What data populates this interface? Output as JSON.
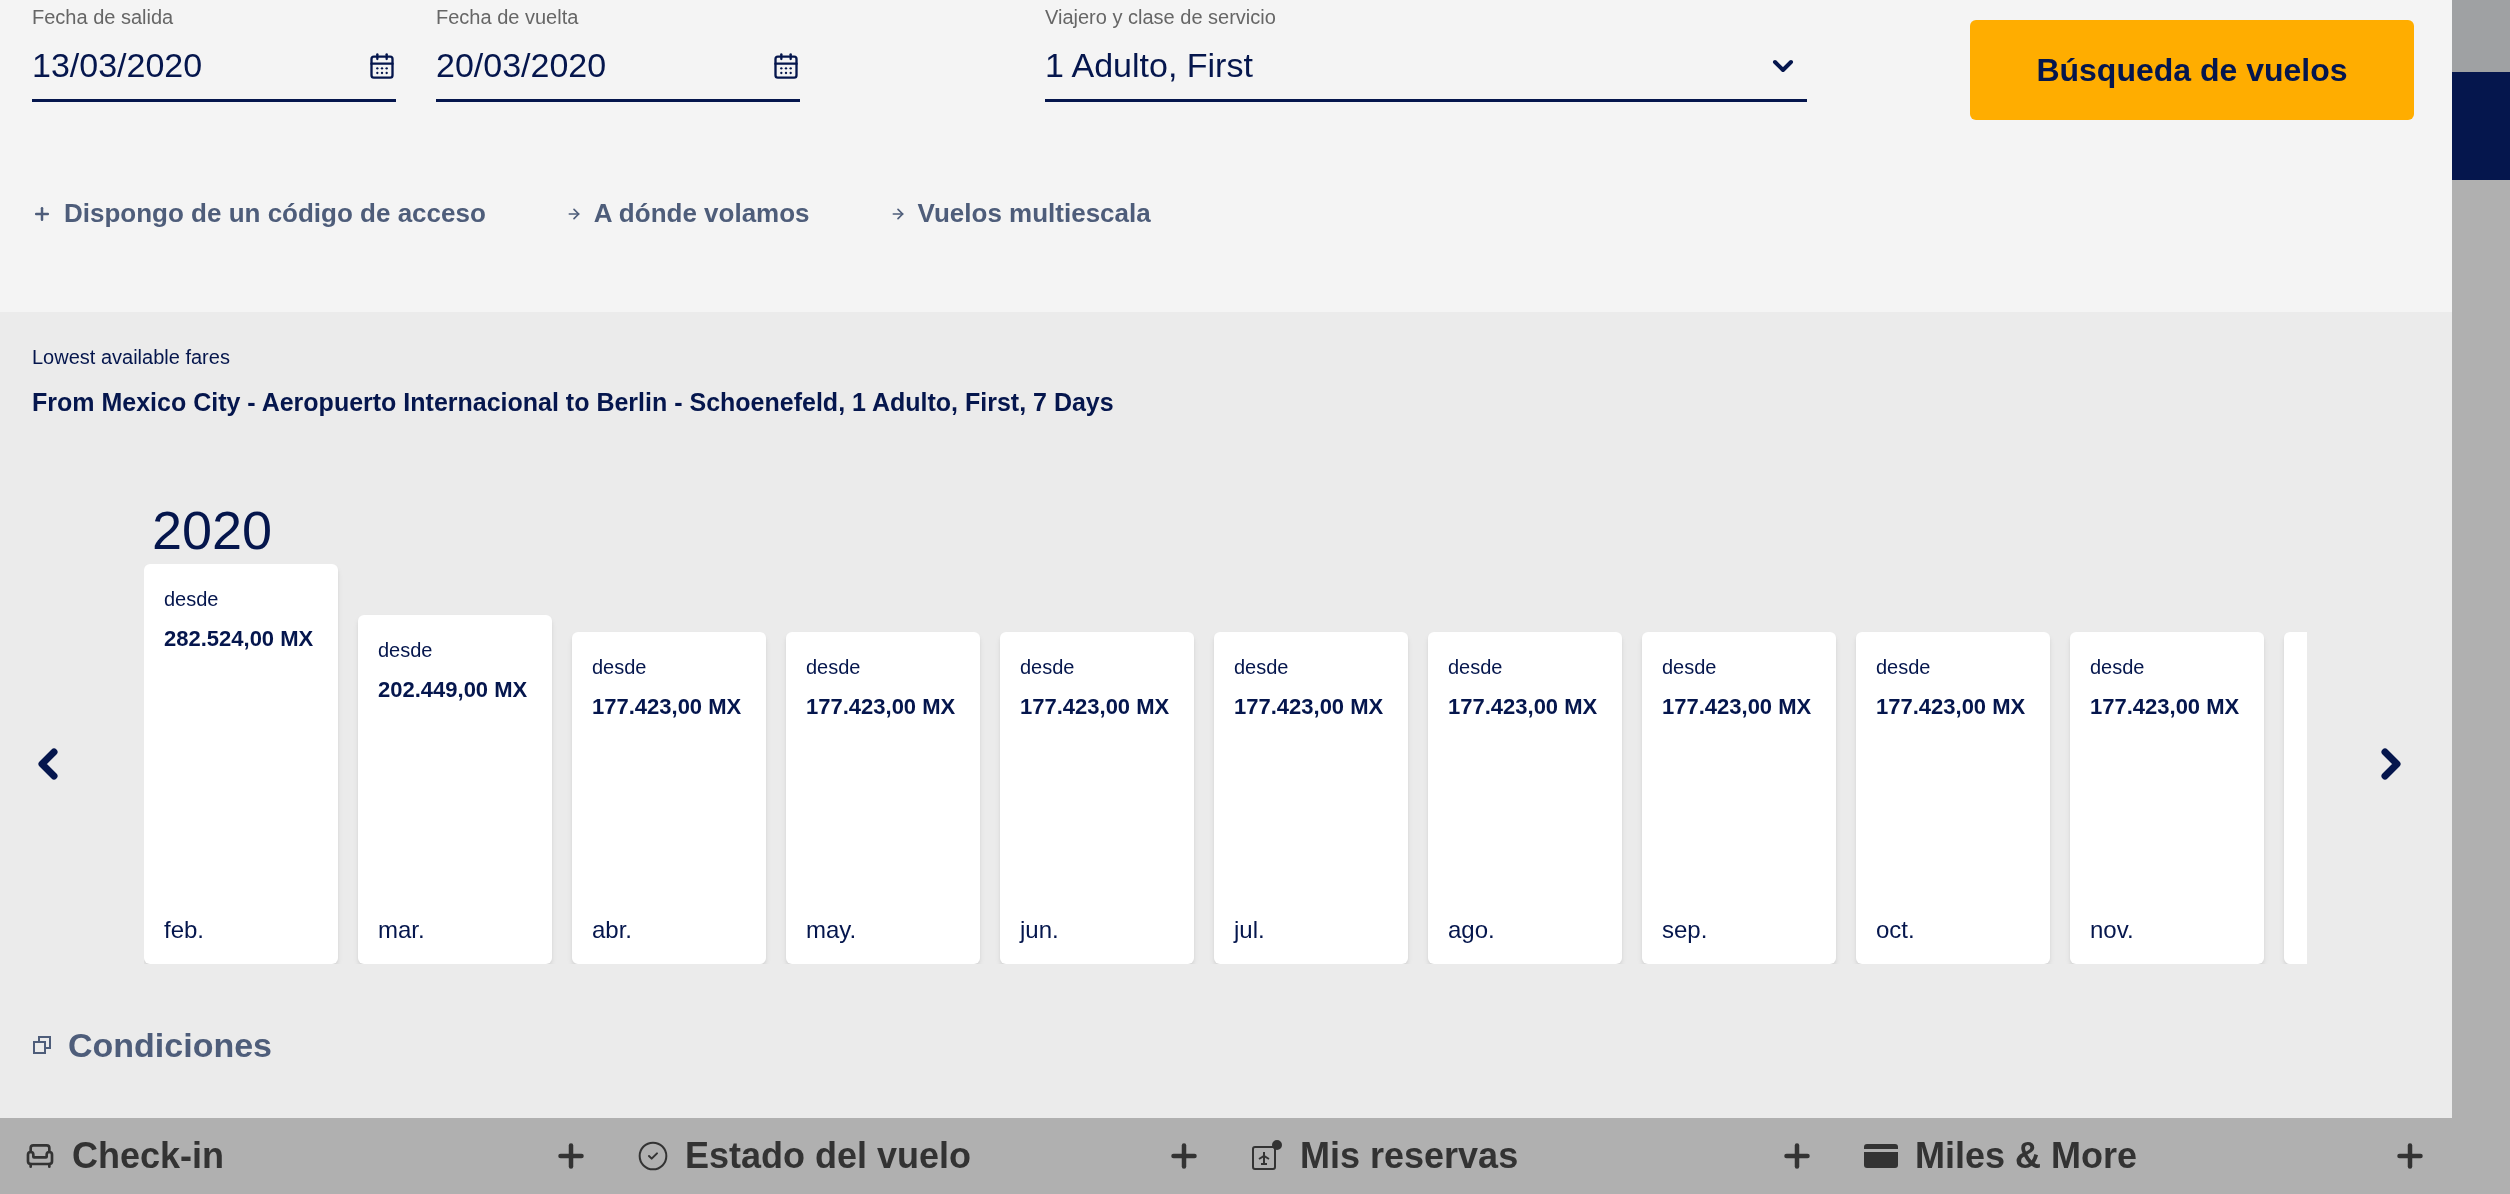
{
  "search_form": {
    "fields": [
      {
        "kind": "date",
        "label": "Fecha de salida",
        "value": "13/03/2020"
      },
      {
        "kind": "date",
        "label": "Fecha de vuelta",
        "value": "20/03/2020"
      },
      {
        "kind": "select",
        "label": "Viajero y clase de servicio",
        "value": "1 Adulto, First"
      }
    ],
    "search_button": "Búsqueda de vuelos",
    "links": [
      {
        "kind": "plus",
        "label": "Dispongo de un código de acceso"
      },
      {
        "kind": "arrow",
        "label": "A dónde volamos"
      },
      {
        "kind": "arrow",
        "label": "Vuelos multiescala"
      }
    ]
  },
  "fares": {
    "caption": "Lowest available fares",
    "route": "From Mexico City - Aeropuerto Internacional to Berlin - Schoenefeld, 1 Adulto, First, 7 Days",
    "year": "2020",
    "months": [
      {
        "prefix": "desde",
        "price": "282.524,00 MX",
        "month": "feb."
      },
      {
        "prefix": "desde",
        "price": "202.449,00 MX",
        "month": "mar."
      },
      {
        "prefix": "desde",
        "price": "177.423,00 MX",
        "month": "abr."
      },
      {
        "prefix": "desde",
        "price": "177.423,00 MX",
        "month": "may."
      },
      {
        "prefix": "desde",
        "price": "177.423,00 MX",
        "month": "jun."
      },
      {
        "prefix": "desde",
        "price": "177.423,00 MX",
        "month": "jul."
      },
      {
        "prefix": "desde",
        "price": "177.423,00 MX",
        "month": "ago."
      },
      {
        "prefix": "desde",
        "price": "177.423,00 MX",
        "month": "sep."
      },
      {
        "prefix": "desde",
        "price": "177.423,00 MX",
        "month": "oct."
      },
      {
        "prefix": "desde",
        "price": "177.423,00 MX",
        "month": "nov."
      }
    ],
    "conditions": "Condiciones"
  },
  "bottom_bar": [
    {
      "kind": "checkin",
      "label": "Check-in"
    },
    {
      "kind": "status",
      "label": "Estado del vuelo"
    },
    {
      "kind": "bookings",
      "label": "Mis reservas"
    },
    {
      "kind": "miles",
      "label": "Miles & More"
    }
  ]
}
